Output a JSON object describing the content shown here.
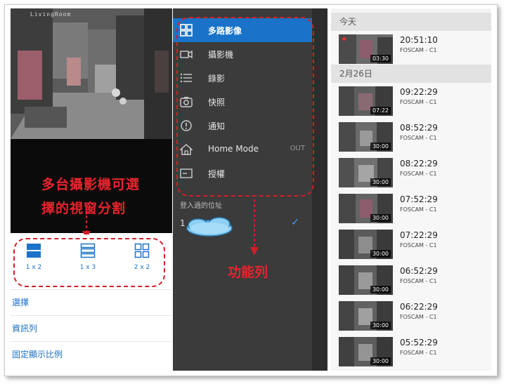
{
  "panel_layout": {
    "camera_overlay": "LivingRoom",
    "callout_line1": "多台攝影機可選",
    "callout_line2": "擇的視窗分割",
    "layouts": [
      {
        "label": "1 x 2",
        "icon": "layout-1x2-icon"
      },
      {
        "label": "1 x 3",
        "icon": "layout-1x3-icon"
      },
      {
        "label": "2 x 2",
        "icon": "layout-2x2-icon"
      }
    ],
    "menu": [
      "選擇",
      "資訊列",
      "固定顯示比例"
    ]
  },
  "panel_drawer": {
    "items": [
      {
        "label": "多路影像",
        "icon": "grid-icon",
        "active": true,
        "tail": ""
      },
      {
        "label": "攝影機",
        "icon": "camera-icon",
        "active": false,
        "tail": ""
      },
      {
        "label": "錄影",
        "icon": "list-icon",
        "active": false,
        "tail": ""
      },
      {
        "label": "快照",
        "icon": "snapshot-icon",
        "active": false,
        "tail": ""
      },
      {
        "label": "通知",
        "icon": "notification-icon",
        "active": false,
        "tail": ""
      },
      {
        "label": "Home Mode",
        "icon": "home-icon",
        "active": false,
        "tail": "OUT"
      },
      {
        "label": "授權",
        "icon": "license-icon",
        "active": false,
        "tail": ""
      }
    ],
    "login_label": "登入過的位址",
    "login_address": "1      .00",
    "callout": "功能列"
  },
  "panel_recordings": {
    "sections": [
      {
        "header": "今天",
        "items": [
          {
            "time": "20:51:10",
            "source": "FOSCAM - C1",
            "duration": "03:30",
            "recording": true
          }
        ]
      },
      {
        "header": "2月26日",
        "items": [
          {
            "time": "09:22:29",
            "source": "FOSCAM - C1",
            "duration": "07:22"
          },
          {
            "time": "08:52:29",
            "source": "FOSCAM - C1",
            "duration": "30:00"
          },
          {
            "time": "08:22:29",
            "source": "FOSCAM - C1",
            "duration": "30:00"
          },
          {
            "time": "07:52:29",
            "source": "FOSCAM - C1",
            "duration": "30:00"
          },
          {
            "time": "07:22:29",
            "source": "FOSCAM - C1",
            "duration": "30:00"
          },
          {
            "time": "06:52:29",
            "source": "FOSCAM - C1",
            "duration": "30:00"
          },
          {
            "time": "06:22:29",
            "source": "FOSCAM - C1",
            "duration": "30:00"
          },
          {
            "time": "05:52:29",
            "source": "FOSCAM - C1",
            "duration": "30:00"
          }
        ]
      }
    ]
  },
  "colors": {
    "accent": "#1a73c9",
    "callout_red": "#e8242d",
    "drawer_bg": "#3b3b3b"
  }
}
